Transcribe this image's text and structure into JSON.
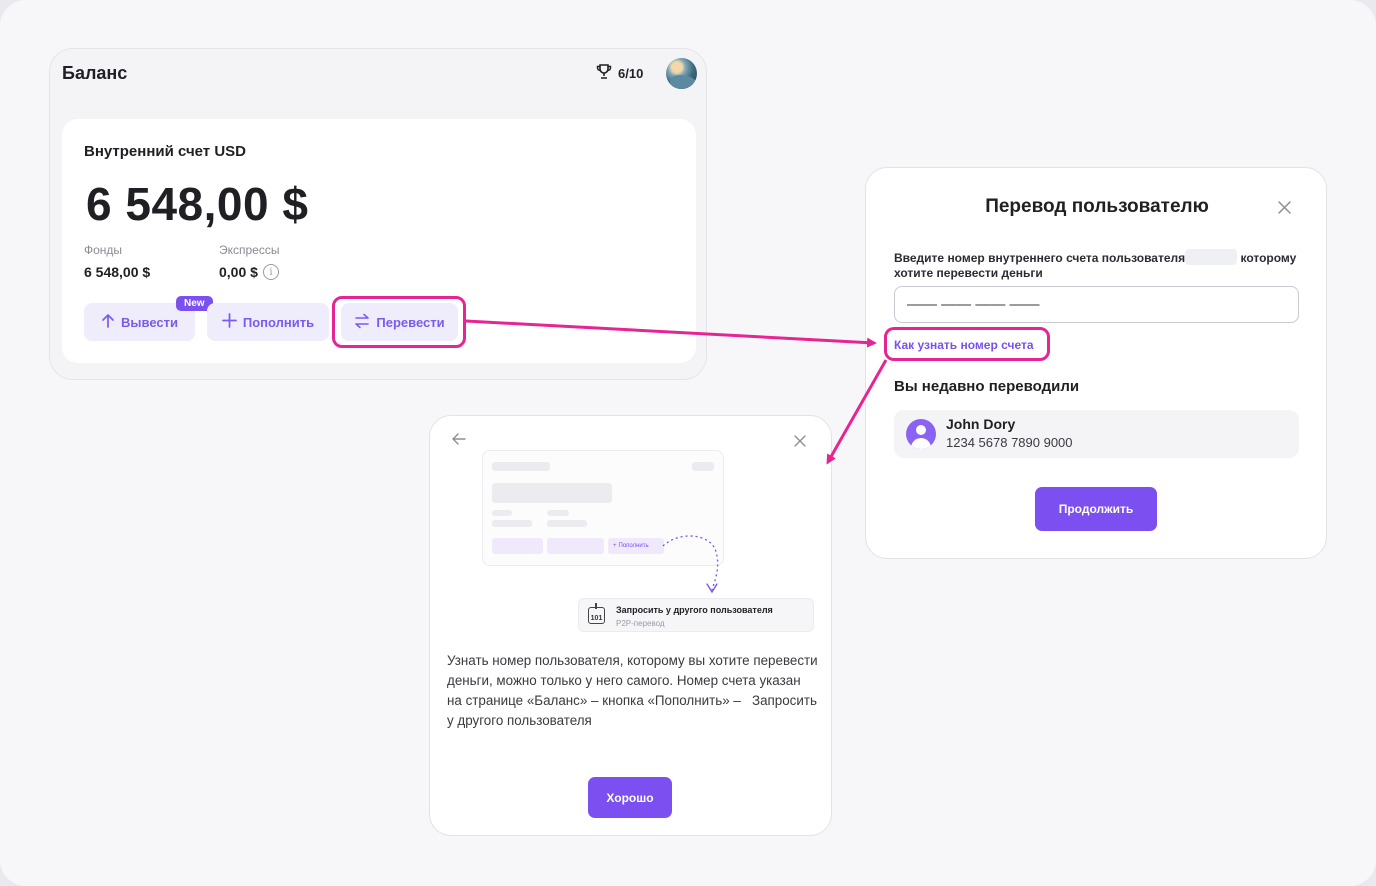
{
  "balance": {
    "title": "Баланс",
    "achievements": "6/10",
    "account_title": "Внутренний счет USD",
    "amount": "6 548,00 $",
    "funds_label": "Фонды",
    "funds_value": "6 548,00 $",
    "express_label": "Экспрессы",
    "express_value": "0,00 $",
    "info_icon_glyph": "i",
    "badge": "New",
    "buttons": {
      "withdraw": "Вывести",
      "deposit": "Пополнить",
      "transfer": "Перевести"
    }
  },
  "transfer": {
    "title": "Перевод пользователю",
    "prompt_part1": "Введите номер внутреннего счета пользователя",
    "prompt_part2": "которому хотите перевести деньги",
    "input_placeholder": "—— —— —— ——",
    "how_link": "Как узнать номер счета",
    "recent_title": "Вы недавно переводили",
    "recent_name": "John Dory",
    "recent_account": "1234 5678 7890 9000",
    "continue_button": "Продолжить"
  },
  "help": {
    "mini_add_label": "Пополнить",
    "request_title": "Запросить у другого пользователя",
    "request_sub": "P2P-перевод",
    "request_icon_text": "101",
    "text": "Узнать номер пользователя, которому вы хотите перевести деньги, можно только у него самого. Номер счета указан на странице «Баланс» – кнопка «Пополнить» –   Запросить у другого пользователя",
    "ok_button": "Хорошо"
  },
  "colors": {
    "accent": "#7b4ff0",
    "highlight": "#e62594",
    "button_bg": "#efecfb"
  },
  "icons": [
    "trophy-icon",
    "avatar",
    "arrow-up-icon",
    "plus-icon",
    "swap-icon",
    "info-icon",
    "close-icon",
    "back-arrow-icon",
    "user-icon",
    "request-icon"
  ]
}
